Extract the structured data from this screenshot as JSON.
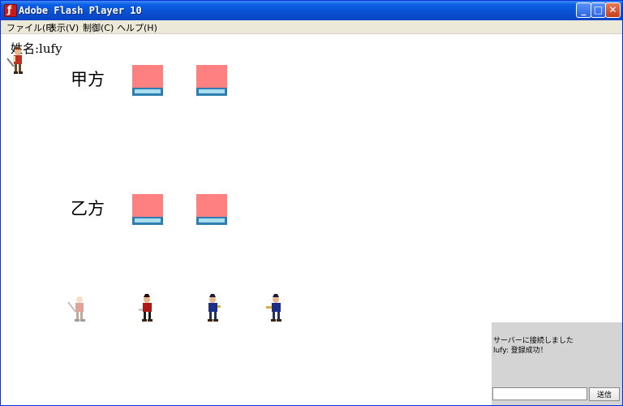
{
  "window": {
    "title": "Adobe Flash Player 10",
    "app_icon_glyph": "ƒ",
    "buttons": {
      "minimize": "_",
      "maximize": "□",
      "close": "✕"
    }
  },
  "menubar": {
    "items": [
      {
        "label": "ファイル(F)"
      },
      {
        "label": "表示(V)"
      },
      {
        "label": "制御(C)"
      },
      {
        "label": "ヘルプ(H)"
      }
    ]
  },
  "stage": {
    "name_label": "姓名:lufy",
    "teams": [
      {
        "label": "甲方",
        "slots": 2
      },
      {
        "label": "乙方",
        "slots": 2
      }
    ],
    "slot_colors": {
      "card": "#ff8080",
      "base": "#2e7fb0"
    },
    "characters": [
      {
        "icon": "warrior-sprite-icon",
        "faded": true
      },
      {
        "icon": "warrior-sprite-icon",
        "color": "#b01818"
      },
      {
        "icon": "warrior-sprite-icon",
        "color": "#1c2f86"
      },
      {
        "icon": "warrior-sprite-icon",
        "color": "#1c2f86"
      }
    ]
  },
  "chat": {
    "messages": [
      "サーバーに接続しました",
      "lufy: 登録成功！"
    ],
    "input_value": "",
    "send_label": "送信"
  }
}
